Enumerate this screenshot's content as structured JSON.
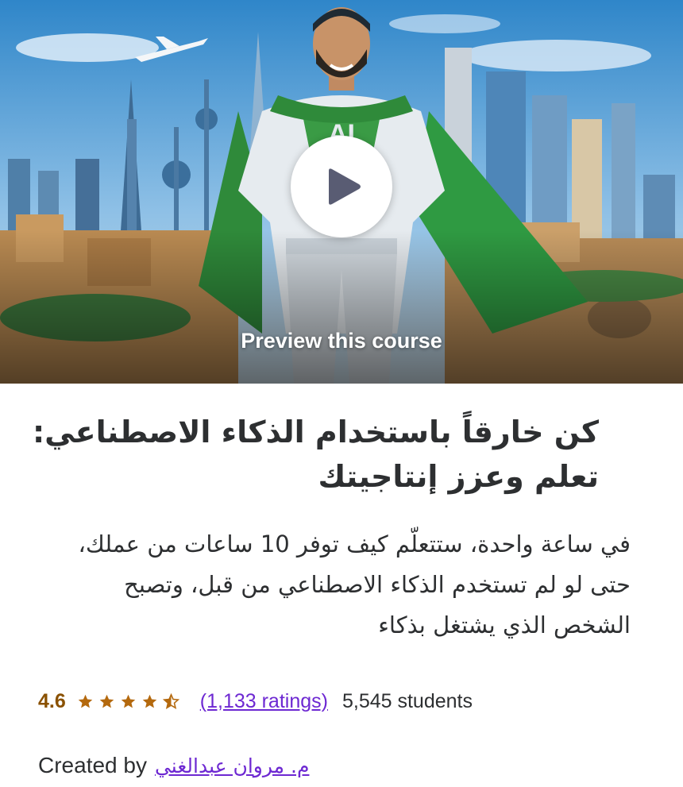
{
  "preview": {
    "label": "Preview this course",
    "image_description_icon": "superhero-ai-city-illustration",
    "play_icon": "play-icon"
  },
  "course": {
    "title_line1": "كن خارقاً باستخدام الذكاء الاصطناعي:",
    "title_line2": "تعلم وعزز إنتاجيتك",
    "description_line1": "في ساعة واحدة، ستتعلّم كيف توفر 10 ساعات من عملك،",
    "description_line2": "حتى لو لم تستخدم الذكاء الاصطناعي من قبل، وتصبح",
    "description_line3": "الشخص الذي يشتغل بذكاء",
    "rating": "4.6",
    "rating_numeric": 4.6,
    "ratings_count": "(1,133 ratings)",
    "students": "5,545 students",
    "created_by_label": "Created by",
    "creator": "م. مروان عبدالغني"
  },
  "colors": {
    "rating": "#8a5100",
    "star": "#b4690e",
    "link": "#6d28d2",
    "text": "#2d2f31",
    "play_triangle": "#595c73"
  }
}
